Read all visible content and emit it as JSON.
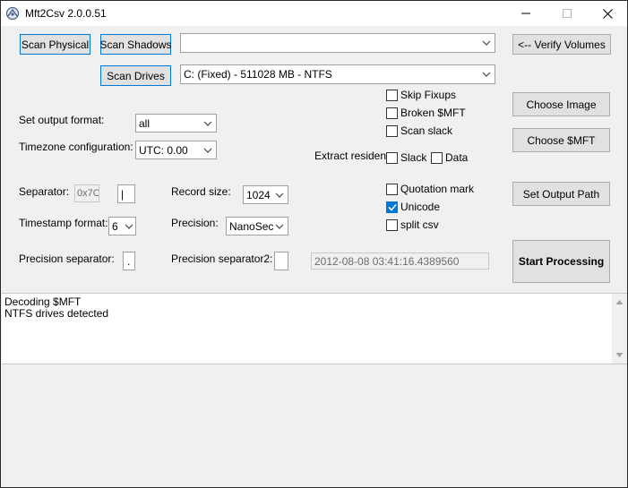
{
  "window": {
    "title": "Mft2Csv 2.0.0.51"
  },
  "buttons": {
    "scan_physical": "Scan Physical",
    "scan_shadows": "Scan Shadows",
    "scan_drives": "Scan Drives",
    "verify_volumes": "<-- Verify Volumes",
    "choose_image": "Choose Image",
    "choose_mft": "Choose $MFT",
    "set_output_path": "Set Output Path",
    "start_processing": "Start Processing"
  },
  "combos": {
    "volume_select": "",
    "drive_select": "C:  (Fixed)  - 511028 MB  - NTFS",
    "output_format": "all",
    "timezone": "UTC: 0.00",
    "record_size": "1024",
    "timestamp_format": "6",
    "precision": "NanoSec"
  },
  "labels": {
    "output_format": "Set output format:",
    "timezone": "Timezone configuration:",
    "separator": "Separator:",
    "record_size": "Record size:",
    "timestamp_format": "Timestamp format:",
    "precision": "Precision:",
    "precision_separator": "Precision separator:",
    "precision_separator2": "Precision separator2:",
    "extract_resident": "Extract resident:"
  },
  "fields": {
    "separator_hex": "0x7C",
    "separator_char": "|",
    "precision_separator": ".",
    "precision_separator2": "",
    "timestamp_preview": "2012-08-08 03:41:16.4389560"
  },
  "checkboxes": [
    {
      "label": "Skip Fixups",
      "checked": false
    },
    {
      "label": "Broken $MFT",
      "checked": false
    },
    {
      "label": "Scan slack",
      "checked": false
    },
    {
      "label": "Slack",
      "checked": false
    },
    {
      "label": "Data",
      "checked": false
    },
    {
      "label": "Quotation mark",
      "checked": false
    },
    {
      "label": "Unicode",
      "checked": true
    },
    {
      "label": "split csv",
      "checked": false
    }
  ],
  "log": {
    "lines": [
      "Decoding $MFT",
      "NTFS drives detected"
    ]
  }
}
